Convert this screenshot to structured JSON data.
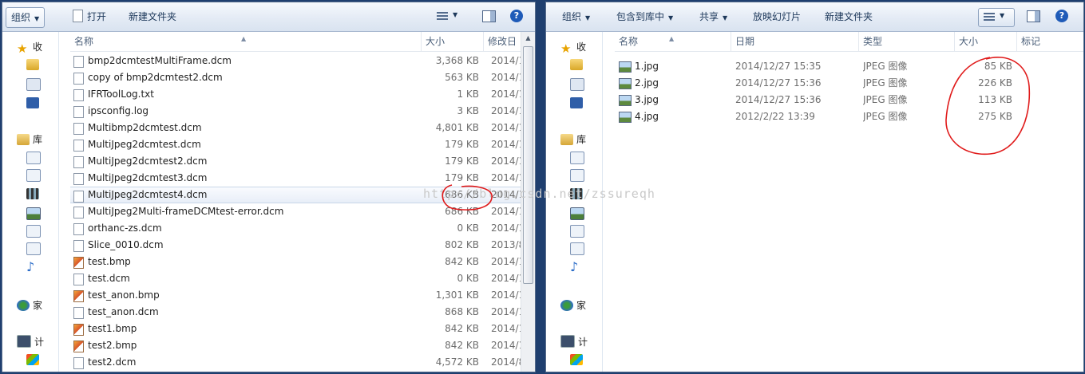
{
  "left": {
    "toolbar": {
      "organize": "组织",
      "open": "打开",
      "new_folder": "新建文件夹"
    },
    "nav": {
      "favorites": "收",
      "libraries": "库",
      "homegroup": "家",
      "computer": "计"
    },
    "columns": {
      "name": "名称",
      "size": "大小",
      "modified": "修改日"
    },
    "files": [
      {
        "name": "bmp2dcmtestMultiFrame.dcm",
        "size": "3,368 KB",
        "date": "2014/1",
        "icon": "doc"
      },
      {
        "name": "copy of bmp2dcmtest2.dcm",
        "size": "563 KB",
        "date": "2014/1",
        "icon": "doc"
      },
      {
        "name": "IFRToolLog.txt",
        "size": "1 KB",
        "date": "2014/1",
        "icon": "doc"
      },
      {
        "name": "ipsconfig.log",
        "size": "3 KB",
        "date": "2014/1",
        "icon": "doc"
      },
      {
        "name": "Multibmp2dcmtest.dcm",
        "size": "4,801 KB",
        "date": "2014/1",
        "icon": "doc"
      },
      {
        "name": "MultiJpeg2dcmtest.dcm",
        "size": "179 KB",
        "date": "2014/1",
        "icon": "doc"
      },
      {
        "name": "MultiJpeg2dcmtest2.dcm",
        "size": "179 KB",
        "date": "2014/1",
        "icon": "doc"
      },
      {
        "name": "MultiJpeg2dcmtest3.dcm",
        "size": "179 KB",
        "date": "2014/1",
        "icon": "doc"
      },
      {
        "name": "MultiJpeg2dcmtest4.dcm",
        "size": "686 KB",
        "date": "2014/1",
        "icon": "doc"
      },
      {
        "name": "MultiJpeg2Multi-frameDCMtest-error.dcm",
        "size": "686 KB",
        "date": "2014/1",
        "icon": "doc"
      },
      {
        "name": "orthanc-zs.dcm",
        "size": "0 KB",
        "date": "2014/1",
        "icon": "doc"
      },
      {
        "name": "Slice_0010.dcm",
        "size": "802 KB",
        "date": "2013/8",
        "icon": "doc"
      },
      {
        "name": "test.bmp",
        "size": "842 KB",
        "date": "2014/1",
        "icon": "bmp"
      },
      {
        "name": "test.dcm",
        "size": "0 KB",
        "date": "2014/1",
        "icon": "doc"
      },
      {
        "name": "test_anon.bmp",
        "size": "1,301 KB",
        "date": "2014/1",
        "icon": "bmp"
      },
      {
        "name": "test_anon.dcm",
        "size": "868 KB",
        "date": "2014/1",
        "icon": "doc"
      },
      {
        "name": "test1.bmp",
        "size": "842 KB",
        "date": "2014/1",
        "icon": "bmp"
      },
      {
        "name": "test2.bmp",
        "size": "842 KB",
        "date": "2014/1",
        "icon": "bmp"
      },
      {
        "name": "test2.dcm",
        "size": "4,572 KB",
        "date": "2014/8",
        "icon": "doc"
      }
    ],
    "selected_index": 8
  },
  "right": {
    "toolbar": {
      "organize": "组织",
      "include_library": "包含到库中",
      "share": "共享",
      "slideshow": "放映幻灯片",
      "new_folder": "新建文件夹"
    },
    "nav": {
      "favorites": "收",
      "libraries": "库",
      "homegroup": "家",
      "computer": "计"
    },
    "columns": {
      "name": "名称",
      "date": "日期",
      "type": "类型",
      "size": "大小",
      "tags": "标记"
    },
    "files": [
      {
        "name": "1.jpg",
        "date": "2014/12/27 15:35",
        "type": "JPEG 图像",
        "size": "85 KB"
      },
      {
        "name": "2.jpg",
        "date": "2014/12/27 15:36",
        "type": "JPEG 图像",
        "size": "226 KB"
      },
      {
        "name": "3.jpg",
        "date": "2014/12/27 15:36",
        "type": "JPEG 图像",
        "size": "113 KB"
      },
      {
        "name": "4.jpg",
        "date": "2012/2/22 13:39",
        "type": "JPEG 图像",
        "size": "275 KB"
      }
    ]
  },
  "watermark": "http://blog.csdn.net/zssureqh",
  "colors": {
    "annotation": "#e01b1b",
    "selection": "#e8eef8",
    "toolbar": "#dfe8f4",
    "frame": "#1f3f6f"
  }
}
